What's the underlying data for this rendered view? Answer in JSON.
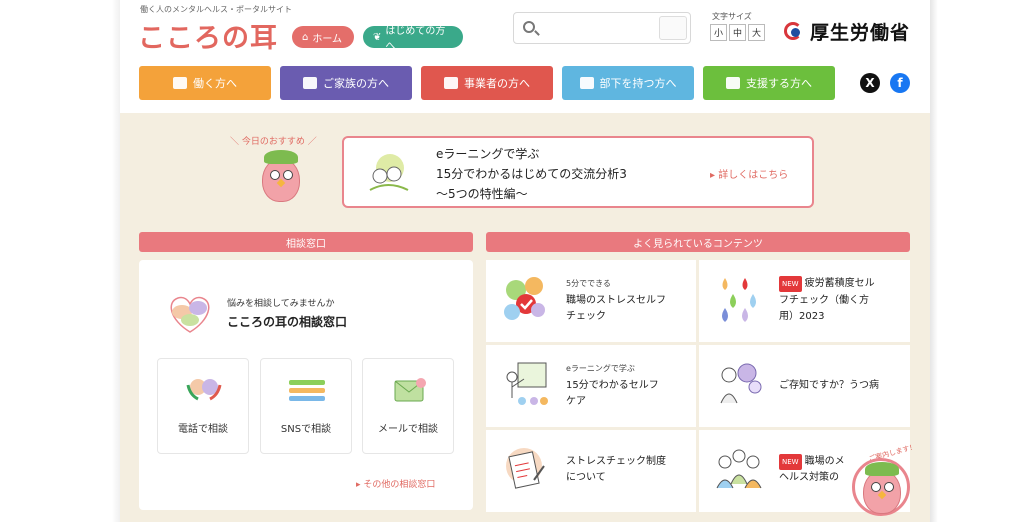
{
  "header": {
    "tagline": "働く人のメンタルヘルス・ポータルサイト",
    "logo": "こころの耳",
    "home_label": "ホーム",
    "first_time_label": "はじめての方へ",
    "font_size_label": "文字サイズ",
    "font_sizes": [
      "小",
      "中",
      "大"
    ],
    "ministry": "厚生労働省"
  },
  "nav": {
    "items": [
      {
        "label": "働く方へ",
        "color": "#f4a23a"
      },
      {
        "label": "ご家族の方へ",
        "color": "#6a5cb0"
      },
      {
        "label": "事業者の方へ",
        "color": "#e0574e"
      },
      {
        "label": "部下を持つ方へ",
        "color": "#5fb6e0"
      },
      {
        "label": "支援する方へ",
        "color": "#6cbf3d"
      }
    ],
    "social_x": "X",
    "social_fb": "f"
  },
  "recommend": {
    "label": "＼ 今日のおすすめ ／",
    "line1": "eラーニングで学ぶ",
    "line2": "15分でわかるはじめての交流分析3",
    "line3": "〜5つの特性編〜",
    "more": "▸ 詳しくはこちら"
  },
  "consult": {
    "heading": "相談窓口",
    "lead_small": "悩みを相談してみませんか",
    "lead_big": "こころの耳の相談窓口",
    "options": [
      "電話で相談",
      "SNSで相談",
      "メールで相談"
    ],
    "other": "▸ その他の相談窓口"
  },
  "popular": {
    "heading": "よく見られているコンテンツ",
    "items": [
      {
        "small": "5分でできる",
        "title_l1": "職場のストレスセルフ",
        "title_l2": "チェック",
        "title_l3": "",
        "is_new": false
      },
      {
        "small": "",
        "title_l1": "疲労蓄積度セル",
        "title_l2": "フチェック（働く方",
        "title_l3": "用）2023",
        "is_new": true
      },
      {
        "small": "eラーニングで学ぶ",
        "title_l1": "15分でわかるセルフ",
        "title_l2": "ケア",
        "title_l3": "",
        "is_new": false
      },
      {
        "small": "",
        "title_l1": "ご存知ですか？うつ病",
        "title_l2": "",
        "title_l3": "",
        "is_new": false
      },
      {
        "small": "",
        "title_l1": "ストレスチェック制度",
        "title_l2": "について",
        "title_l3": "",
        "is_new": false
      },
      {
        "small": "",
        "title_l1": "職場のメ",
        "title_l2": "ヘルス対策の",
        "title_l3": "",
        "is_new": true
      }
    ],
    "new_badge": "NEW"
  },
  "guide": {
    "label": "ご案内します！"
  }
}
